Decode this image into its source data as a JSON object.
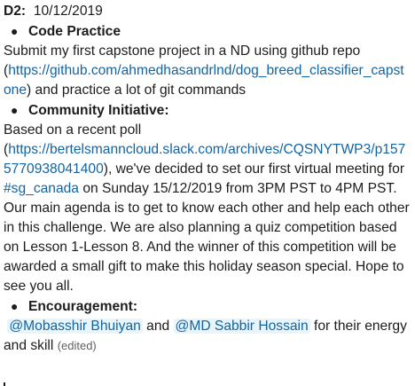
{
  "message": {
    "day_label": "D2:",
    "day_date": "10/12/2019",
    "sections": [
      {
        "title": "Code Practice",
        "text_before": "Submit my first capstone project in a ND using  github repo (",
        "link": "https://github.com/ahmedhasandrlnd/dog_breed_classifier_capstone",
        "text_after": ") and practice a lot of git commands"
      },
      {
        "title": "Community Initiative:",
        "intro": "Based on a recent poll",
        "link": "https://bertelsmanncloud.slack.com/archives/CQSNYTWP3/p1575770938041400",
        "text_a": "), we've decided to set our first virtual meeting for ",
        "channel": "#sg_canada",
        "text_b": " on Sunday 15/12/2019 from 3PM PST to 4PM PST. Our main agenda is to get to know each other and help each other in this challenge. We are also planning a quiz competition based on Lesson 1-Lesson 8. And the winner of this competition will be awarded a small gift to make this holiday season special. Hope to see you all."
      },
      {
        "title": "Encouragement:",
        "mention_1": "@Mobasshir Bhuiyan",
        "joiner": "and",
        "mention_2": "@MD Sabbir Hossain",
        "text_after": " for their energy and skill",
        "edited": "(edited)"
      }
    ]
  }
}
